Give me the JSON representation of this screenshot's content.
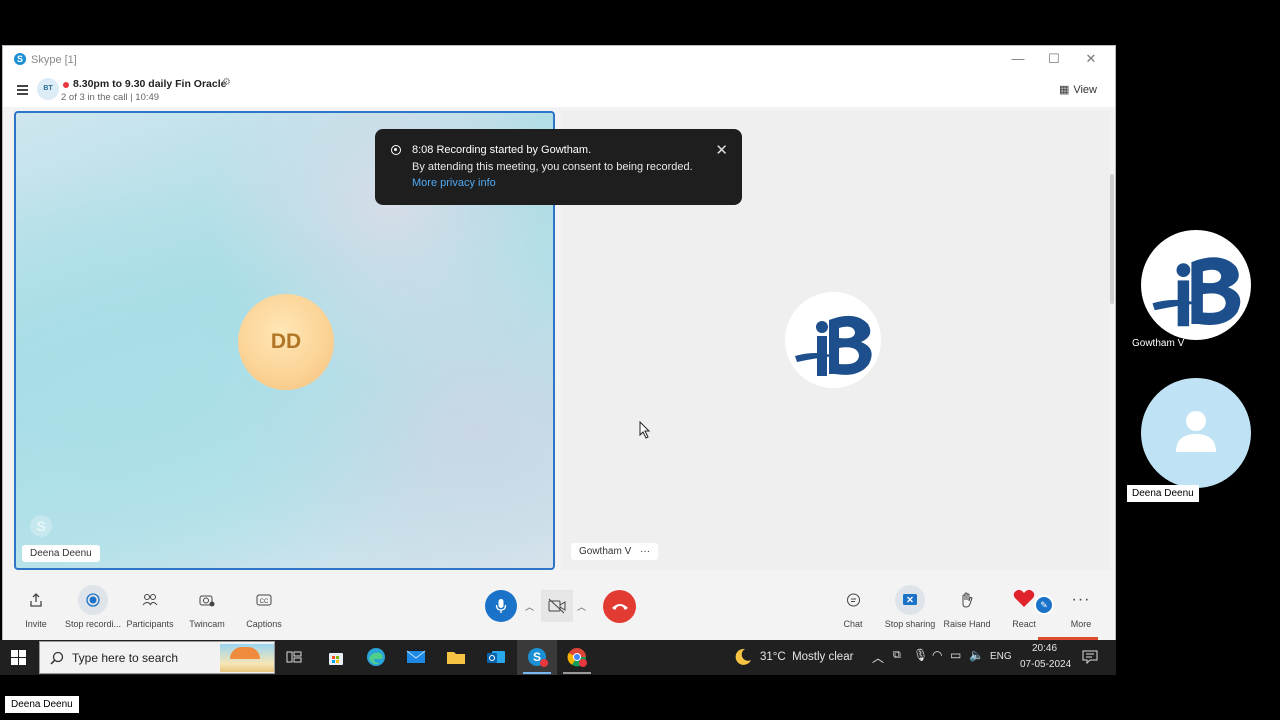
{
  "window": {
    "title": "Skype [1]",
    "controls": {
      "minimize": "—",
      "maximize": "☐",
      "close": "✕"
    }
  },
  "call_header": {
    "avatar_initials": "BT",
    "meeting_title": "8.30pm to 9.30 daily Fin Oracle",
    "subtitle": "2 of 3 in the call | 10:49",
    "view_label": "View"
  },
  "tiles": {
    "left": {
      "initials": "DD",
      "name": "Deena Deenu"
    },
    "right": {
      "name": "Gowtham V",
      "more": "···"
    }
  },
  "toast": {
    "line1": "8:08 Recording started by Gowtham.",
    "line2": "By attending this meeting, you consent to being recorded.",
    "link": "More privacy info",
    "close": "✕"
  },
  "call_bar": {
    "left_buttons": [
      {
        "label": "Invite",
        "icon": "share-icon"
      },
      {
        "label": "Stop recordi...",
        "icon": "record-icon"
      },
      {
        "label": "Participants",
        "icon": "participants-icon"
      },
      {
        "label": "Twincam",
        "icon": "camera-icon"
      },
      {
        "label": "Captions",
        "icon": "captions-icon"
      }
    ],
    "right_buttons": [
      {
        "label": "Chat",
        "icon": "chat-icon"
      },
      {
        "label": "Stop sharing",
        "icon": "screen-share-icon"
      },
      {
        "label": "Raise Hand",
        "icon": "hand-icon"
      },
      {
        "label": "React",
        "icon": "heart-icon"
      },
      {
        "label": "More",
        "icon": "more-icon"
      }
    ]
  },
  "taskbar": {
    "search_placeholder": "Type here to search",
    "weather": "31°C  Mostly clear",
    "language": "ENG",
    "time": "20:46",
    "date": "07-05-2024"
  },
  "side_participants": [
    {
      "name": "Gowtham V"
    },
    {
      "name": "Deena Deenu"
    }
  ],
  "bottom_label": "Deena Deenu",
  "colors": {
    "accent": "#1b73c9",
    "end_call": "#e23c32",
    "logo_blue": "#1c4f8c",
    "record_red": "#e8373d"
  }
}
